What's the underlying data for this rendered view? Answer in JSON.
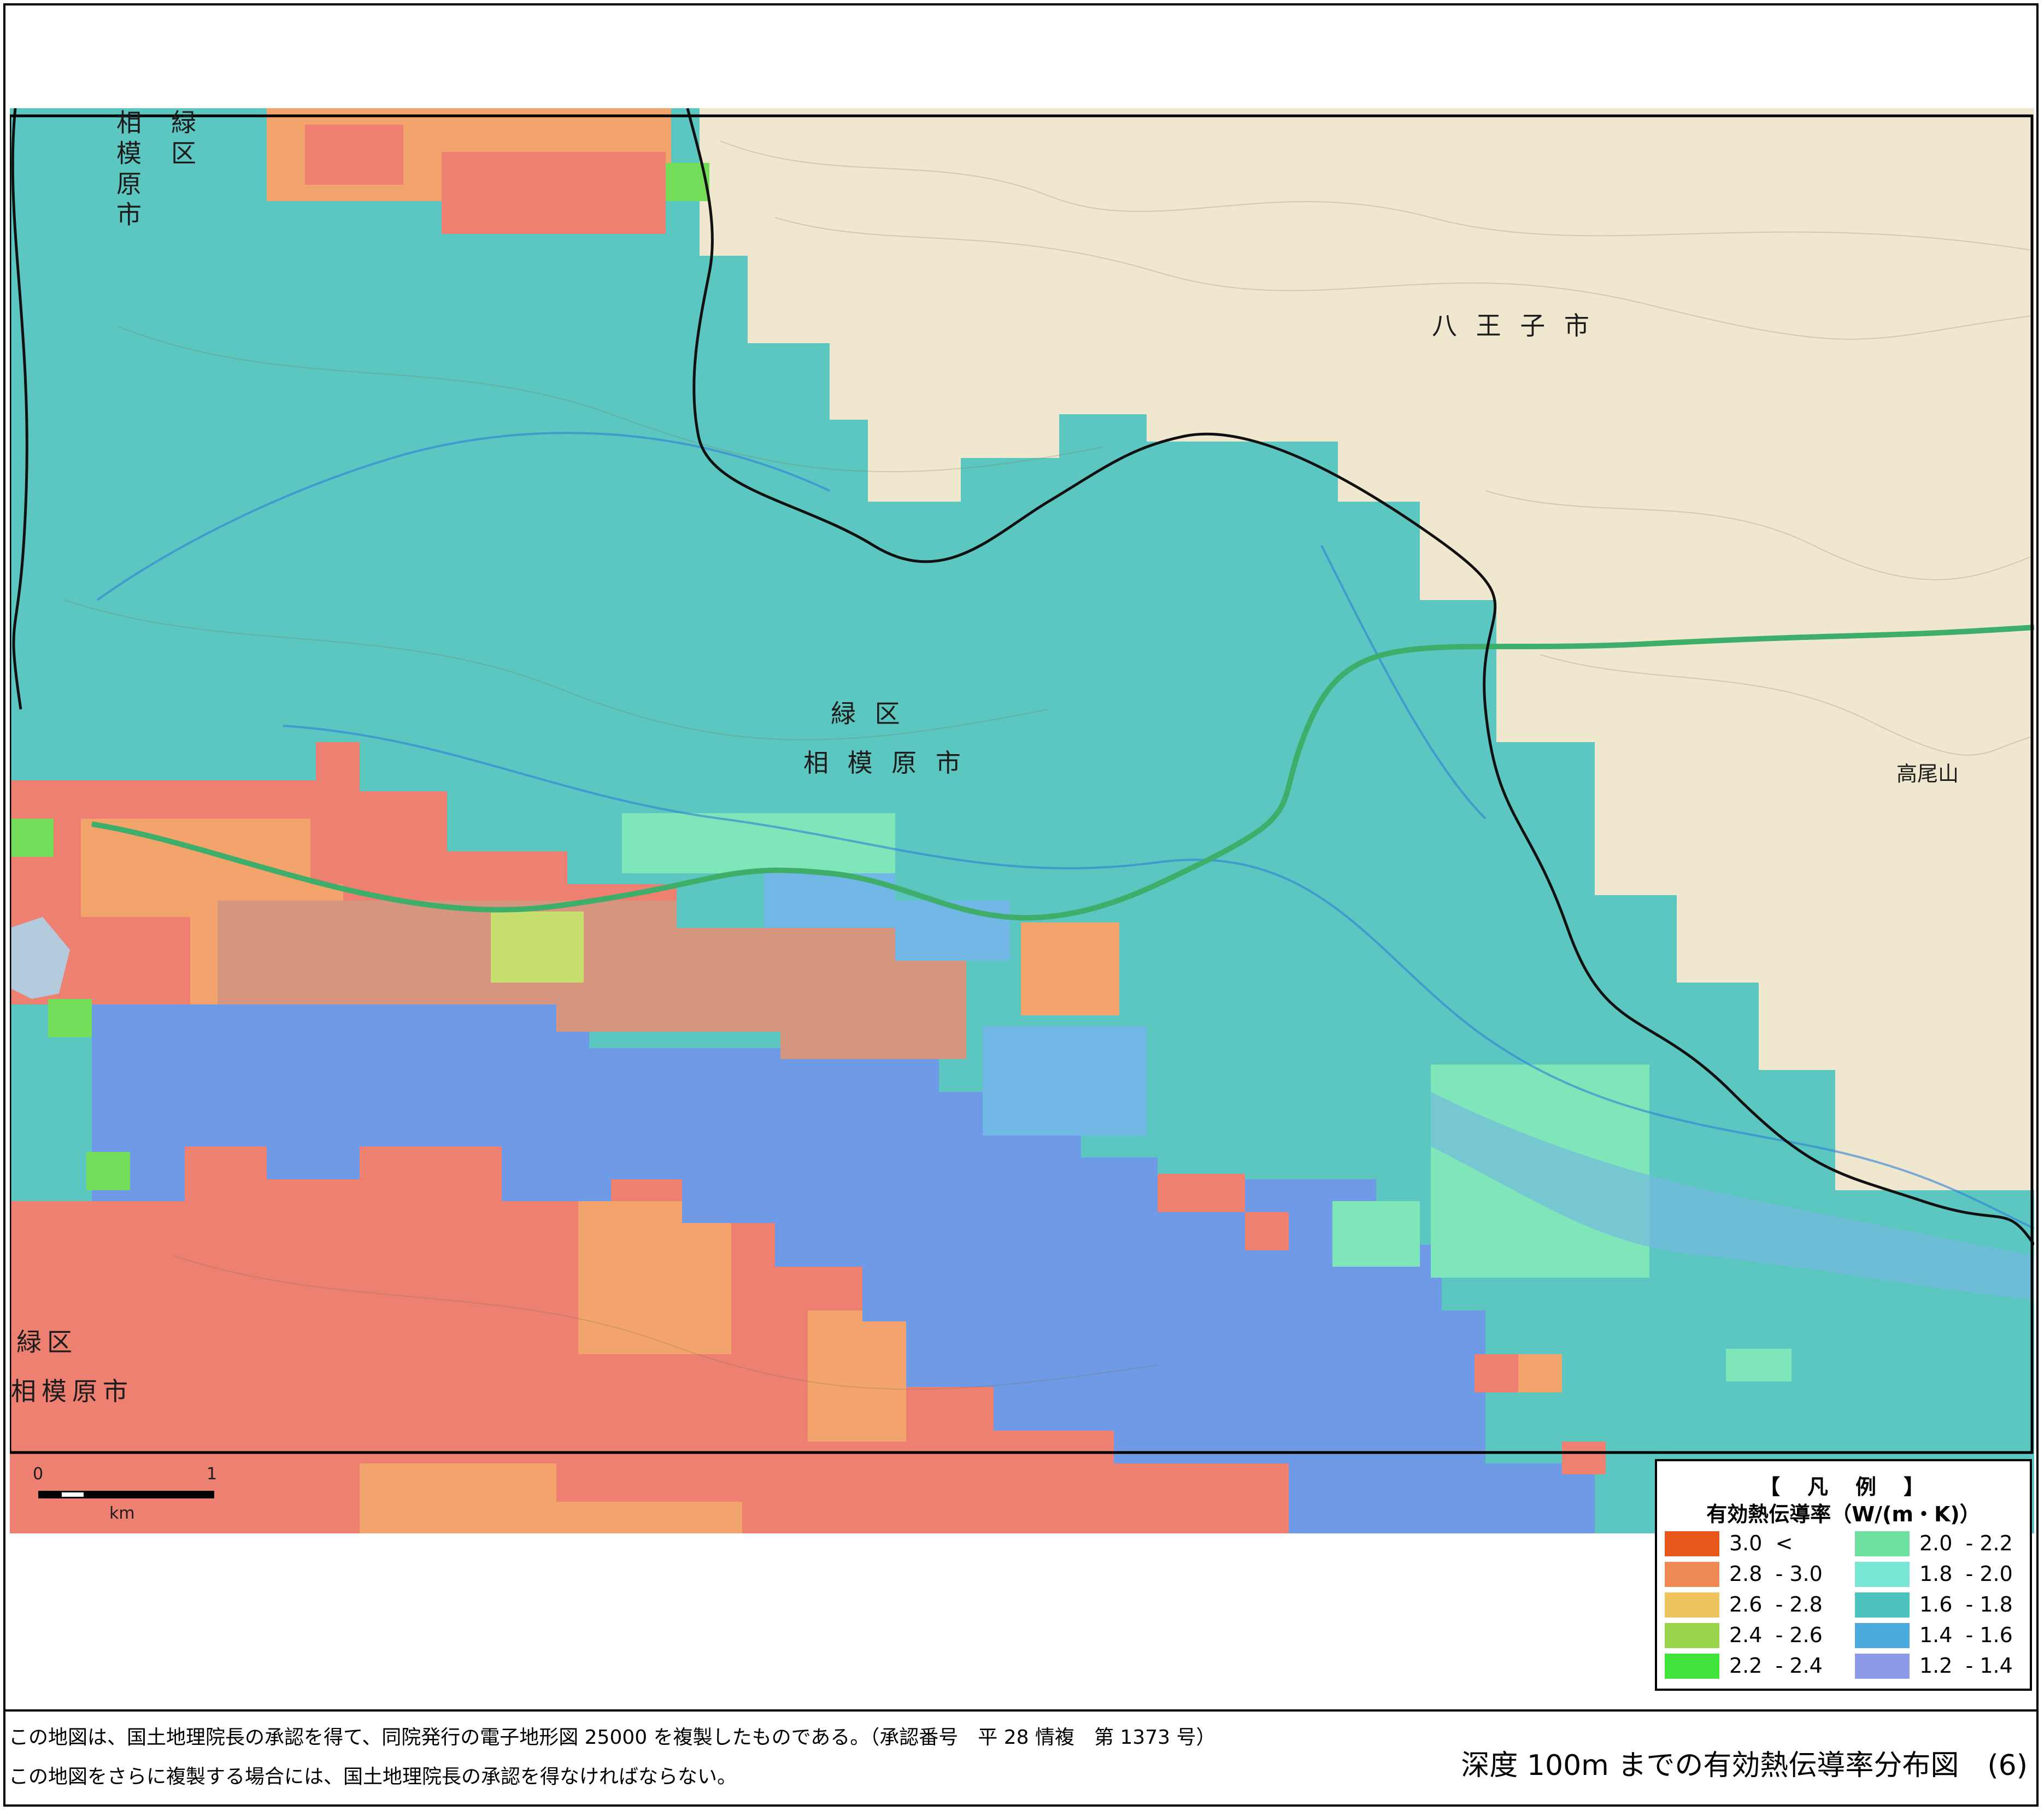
{
  "map": {
    "place_labels": {
      "ward_a": "緑区",
      "city_a": "相模原市",
      "ward_b": "緑 区",
      "city_b": "相 模 原 市",
      "ward_c": "緑区",
      "city_c": "相模原市",
      "hachioji": "八 王 子 市",
      "mt_takao": "高尾山"
    },
    "colors": {
      "base_terrain": "#efe8cf",
      "teal": "#5cc7c1",
      "red": "#ee8072",
      "orange": "#f2a46c",
      "blue": "#6f9be6",
      "lightblue": "#72b8e6",
      "mint": "#7ee6b8",
      "mauve": "#d6957f",
      "yellowgreen": "#c6df6e",
      "green": "#73dd5a",
      "lake": "#a8d8ee"
    }
  },
  "scale_bar": {
    "zero": "0",
    "one": "1",
    "unit": "km"
  },
  "legend": {
    "title": "【　凡　例　】",
    "subtitle": "有効熱伝導率（W/(m・K)）",
    "items": [
      {
        "label": "3.0  <",
        "color": "#e8571a"
      },
      {
        "label": "2.8  - 3.0",
        "color": "#ef8a56"
      },
      {
        "label": "2.6  - 2.8",
        "color": "#f0c45c"
      },
      {
        "label": "2.4  - 2.6",
        "color": "#97d44a"
      },
      {
        "label": "2.2  - 2.4",
        "color": "#3fe33a"
      },
      {
        "label": "2.0  - 2.2",
        "color": "#6fe0a0"
      },
      {
        "label": "1.8  - 2.0",
        "color": "#78e6d3"
      },
      {
        "label": "1.6  - 1.8",
        "color": "#4cc2bd"
      },
      {
        "label": "1.4  - 1.6",
        "color": "#4ba9dc"
      },
      {
        "label": "1.2  - 1.4",
        "color": "#8c9ae6"
      }
    ]
  },
  "footer": {
    "note1": "この地図は、国土地理院長の承認を得て、同院発行の電子地形図 25000 を複製したものである。（承認番号　平 28 情複　第 1373 号）",
    "note2": "この地図をさらに複製する場合には、国土地理院長の承認を得なければならない。",
    "caption": "深度 100m までの有効熱伝導率分布図　(6)"
  }
}
